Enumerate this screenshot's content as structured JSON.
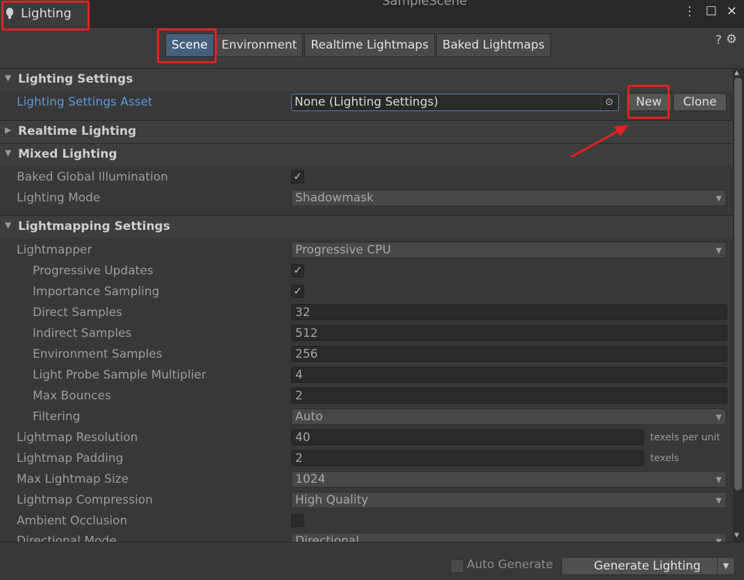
{
  "window": {
    "title": "Lighting",
    "ghost_tab": "SampleScene"
  },
  "tabs": [
    {
      "label": "Scene",
      "active": true
    },
    {
      "label": "Environment",
      "active": false
    },
    {
      "label": "Realtime Lightmaps",
      "active": false
    },
    {
      "label": "Baked Lightmaps",
      "active": false
    }
  ],
  "sections": {
    "lighting_settings": "Lighting Settings",
    "realtime_lighting": "Realtime Lighting",
    "mixed_lighting": "Mixed Lighting",
    "lightmapping_settings": "Lightmapping Settings"
  },
  "lighting_settings_asset": {
    "label": "Lighting Settings Asset",
    "value": "None (Lighting Settings)",
    "new_label": "New",
    "clone_label": "Clone"
  },
  "mixed": {
    "baked_gi_label": "Baked Global Illumination",
    "baked_gi_checked": true,
    "lighting_mode_label": "Lighting Mode",
    "lighting_mode_value": "Shadowmask"
  },
  "lightmapping": {
    "lightmapper_label": "Lightmapper",
    "lightmapper_value": "Progressive CPU",
    "progressive_updates_label": "Progressive Updates",
    "importance_sampling_label": "Importance Sampling",
    "direct_samples_label": "Direct Samples",
    "direct_samples": "32",
    "indirect_samples_label": "Indirect Samples",
    "indirect_samples": "512",
    "environment_samples_label": "Environment Samples",
    "environment_samples": "256",
    "light_probe_label": "Light Probe Sample Multiplier",
    "light_probe": "4",
    "max_bounces_label": "Max Bounces",
    "max_bounces": "2",
    "filtering_label": "Filtering",
    "filtering_value": "Auto",
    "resolution_label": "Lightmap Resolution",
    "resolution": "40",
    "resolution_unit": "texels per unit",
    "padding_label": "Lightmap Padding",
    "padding": "2",
    "padding_unit": "texels",
    "max_size_label": "Max Lightmap Size",
    "max_size_value": "1024",
    "compression_label": "Lightmap Compression",
    "compression_value": "High Quality",
    "ao_label": "Ambient Occlusion",
    "directional_label": "Directional Mode",
    "directional_value": "Directional"
  },
  "bottom": {
    "auto_generate": "Auto Generate",
    "generate": "Generate Lighting"
  },
  "colors": {
    "annotation": "#e52222",
    "active_tab": "#46607c",
    "link": "#5e9ad8"
  }
}
